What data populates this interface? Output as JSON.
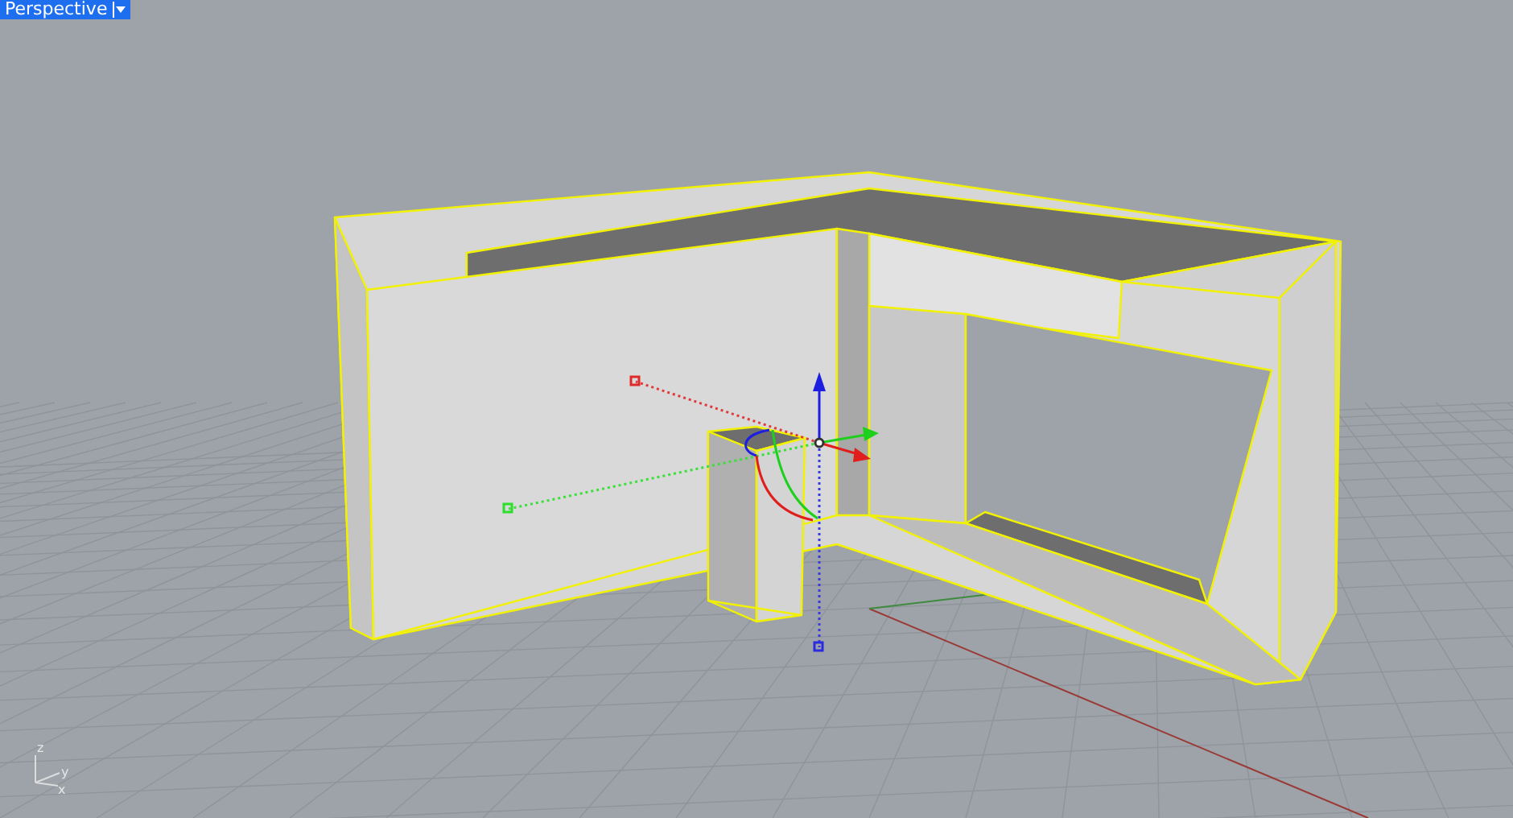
{
  "viewport": {
    "title": "Perspective",
    "active": true
  },
  "axis_triad": {
    "labels": [
      "z",
      "y",
      "x"
    ]
  }
}
